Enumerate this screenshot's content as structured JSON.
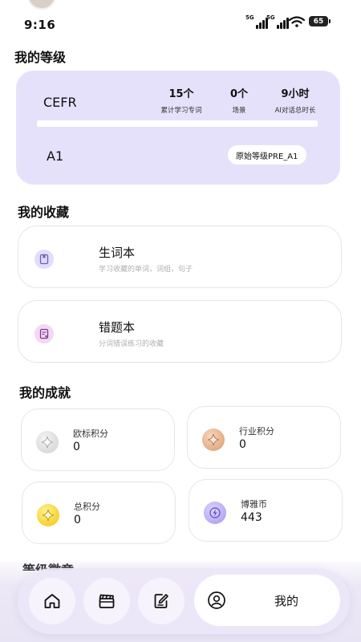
{
  "status_bar": {
    "time": "9:16",
    "signal1_tag": "5G",
    "signal2_tag": "5G",
    "battery": "65"
  },
  "level_section": {
    "title": "我的等级",
    "cefr_label": "CEFR",
    "stats": [
      {
        "value": "15个",
        "label": "累计学习专词"
      },
      {
        "value": "0个",
        "label": "场景"
      },
      {
        "value": "9小时",
        "label": "AI对话总时长"
      }
    ],
    "progress": 0,
    "level": "A1",
    "original_level": "原始等级PRE_A1"
  },
  "favorites_section": {
    "title": "我的收藏",
    "items": [
      {
        "title": "生词本",
        "subtitle": "学习收藏的单词，词组，句子",
        "icon": "bookmark-book-icon"
      },
      {
        "title": "错题本",
        "subtitle": "分词错误练习的收藏",
        "icon": "error-notebook-icon"
      }
    ]
  },
  "achievements_section": {
    "title": "我的成就",
    "items": [
      {
        "label": "欧标积分",
        "value": "0",
        "icon": "silver-star-icon"
      },
      {
        "label": "行业积分",
        "value": "0",
        "icon": "bronze-star-icon"
      },
      {
        "label": "总积分",
        "value": "0",
        "icon": "gold-star-icon"
      },
      {
        "label": "博雅币",
        "value": "443",
        "icon": "coin-bolt-icon"
      }
    ]
  },
  "next_section_partial_title": "等级徽章",
  "bottom_nav": {
    "items": [
      {
        "icon": "home-icon"
      },
      {
        "icon": "clapperboard-icon"
      },
      {
        "icon": "edit-note-icon"
      }
    ],
    "active": {
      "icon": "user-profile-icon",
      "label": "我的"
    }
  },
  "colors": {
    "level_card_bg": "#e6e1fb",
    "accent": "#9c8cf0",
    "nav_bg": "#ece7f8"
  }
}
